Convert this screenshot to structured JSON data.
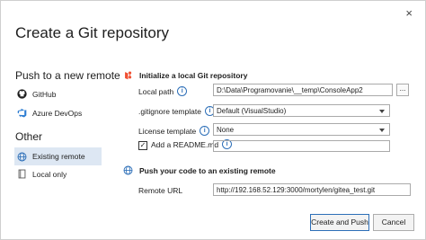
{
  "window": {
    "title": "Create a Git repository",
    "close_glyph": "×"
  },
  "sidebar": {
    "heading": "Push to a new remote",
    "items": [
      {
        "label": "GitHub",
        "icon": "github-icon"
      },
      {
        "label": "Azure DevOps",
        "icon": "azure-devops-icon"
      }
    ],
    "other_heading": "Other",
    "other_items": [
      {
        "label": "Existing remote",
        "icon": "globe-icon",
        "selected": true
      },
      {
        "label": "Local only",
        "icon": "repository-icon",
        "selected": false
      }
    ]
  },
  "init": {
    "heading": "Initialize a local Git repository",
    "local_path_label": "Local path",
    "local_path_value": "D:\\Data\\Programovanie\\__temp\\ConsoleApp2",
    "browse_label": "...",
    "gitignore_label": ".gitignore template",
    "gitignore_value": "Default (VisualStudio)",
    "license_label": "License template",
    "license_value": "None",
    "readme_label": "Add a README.md",
    "readme_checked": true
  },
  "push": {
    "heading": "Push your code to an existing remote",
    "remote_url_label": "Remote URL",
    "remote_url_value": "http://192.168.52.129:3000/mortylen/gitea_test.git"
  },
  "buttons": {
    "create_push": "Create and Push",
    "cancel": "Cancel"
  },
  "colors": {
    "accent": "#2d6fb8",
    "selected_bg": "#dde7f3"
  }
}
